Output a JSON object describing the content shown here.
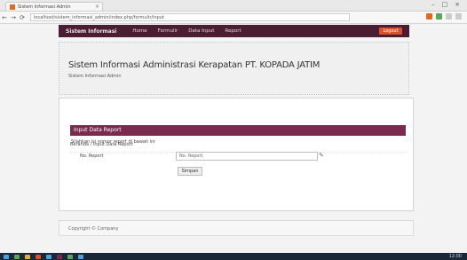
{
  "browser": {
    "tab_title": "Sistem Informasi Admin",
    "tab_close": "×",
    "url": "localhost/sistem_informasi_admin/index.php/formulir/input",
    "controls": [
      "–",
      "□",
      "×"
    ],
    "back": "←",
    "forward": "→",
    "refresh": "⟳"
  },
  "navbar": {
    "brand": "Sistem Informasi",
    "links": [
      "Home",
      "Formulir",
      "Data Input",
      "Report"
    ],
    "logout_label": "Logout"
  },
  "header": {
    "title": "Sistem Informasi Administrasi Kerapatan PT. KOPADA JATIM",
    "subtitle": "Sistem Informasi Admin"
  },
  "panel": {
    "heading": "Input Data Report",
    "breadcrumb": "Beranda / Input Data Report",
    "form_description": "Silahkan isi nomor report di bawah ini",
    "field_label": "No. Report",
    "field_value": "No. Report",
    "submit_label": "Simpan"
  },
  "footer": {
    "text": "Copyright © Company"
  },
  "taskbar": {
    "clock": "12:00"
  },
  "colors": {
    "navbar_bg": "#4a1d33",
    "panel_heading_bg": "#7a2a4e",
    "logout_bg": "#d9502b",
    "taskbar_bg": "#1a2838"
  }
}
